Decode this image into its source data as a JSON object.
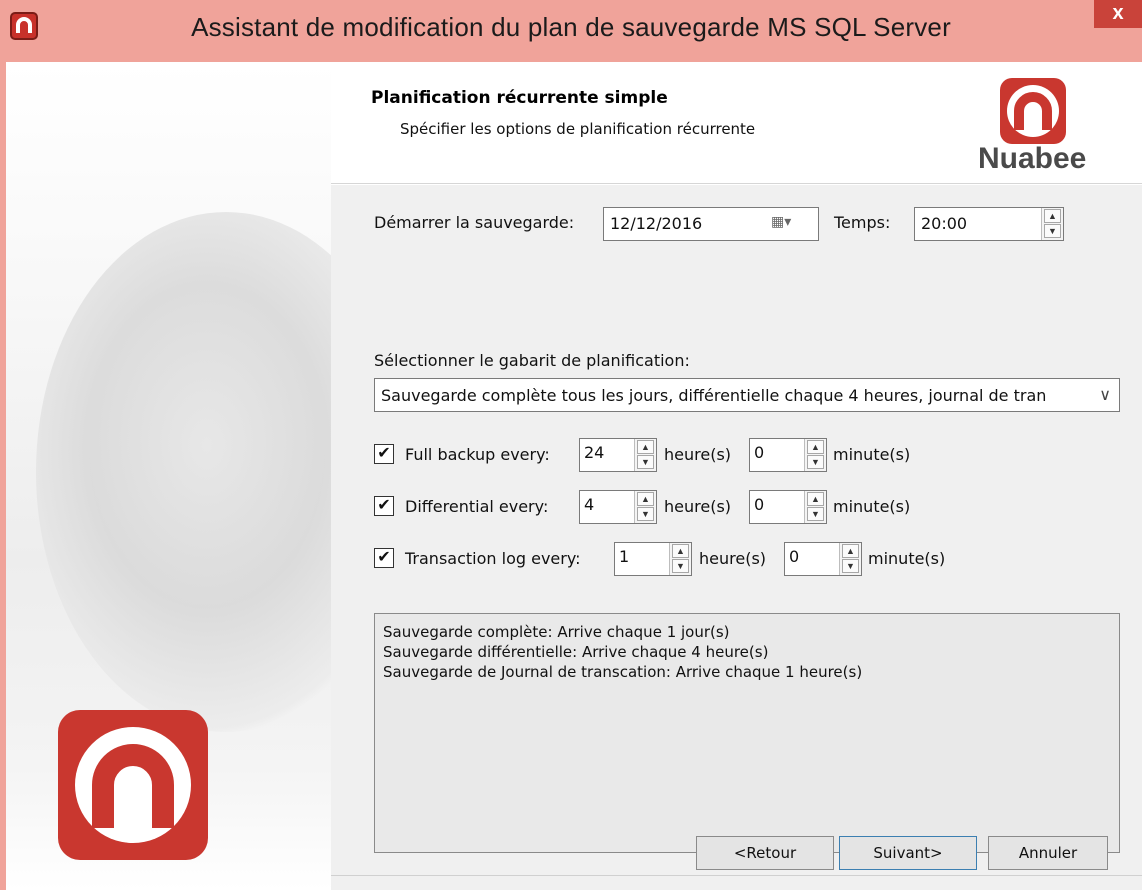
{
  "window": {
    "title": "Assistant de modification du plan de sauvegarde MS SQL Server",
    "close_label": "x"
  },
  "header": {
    "title": "Planification récurrente simple",
    "subtitle": "Spécifier les options de planification récurrente",
    "brand_name": "Nuabee"
  },
  "start": {
    "label": "Démarrer la sauvegarde:",
    "date_value": "12/12/2016",
    "time_label": "Temps:",
    "time_value": "20:00"
  },
  "template": {
    "label": "Sélectionner le gabarit de planification:",
    "selected": "Sauvegarde complète tous les jours, différentielle chaque 4 heures, journal de tran"
  },
  "schedules": [
    {
      "label": "Full backup every:",
      "checked": true,
      "hours": "24",
      "hours_unit": "heure(s)",
      "minutes": "0",
      "minutes_unit": "minute(s)"
    },
    {
      "label": "Differential every:",
      "checked": true,
      "hours": "4",
      "hours_unit": "heure(s)",
      "minutes": "0",
      "minutes_unit": "minute(s)"
    },
    {
      "label": "Transaction log every:",
      "checked": true,
      "hours": "1",
      "hours_unit": "heure(s)",
      "minutes": "0",
      "minutes_unit": "minute(s)"
    }
  ],
  "summary": {
    "lines": [
      "Sauvegarde complète: Arrive chaque 1 jour(s)",
      "Sauvegarde différentielle: Arrive chaque 4 heure(s)",
      "Sauvegarde de Journal de transcation: Arrive chaque 1 heure(s)"
    ]
  },
  "buttons": {
    "back": "<Retour",
    "next": "Suivant>",
    "cancel": "Annuler"
  },
  "icons": {
    "app": "nuabee-logo-icon",
    "calendar": "calendar-icon",
    "spinner_up": "chevron-up-icon",
    "spinner_down": "chevron-down-icon",
    "dropdown": "chevron-down-icon",
    "check": "checkmark-icon"
  },
  "colors": {
    "brand_red": "#c9372f",
    "title_bar": "#f0a39a",
    "panel_bg": "#f0f0f0"
  }
}
